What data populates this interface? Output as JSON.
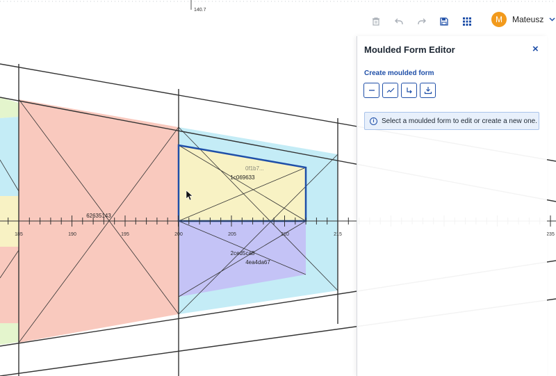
{
  "top_ruler_label": "140.7",
  "ruler": {
    "ticks": [
      "185",
      "190",
      "195",
      "200",
      "205",
      "210",
      "215",
      "235"
    ]
  },
  "shapes": {
    "left_block_label": "62635143",
    "upper_form_label": "1c069633",
    "upper_form_ghost_label": "0f1b7...",
    "lower_form_label": "2ced5ca8",
    "lower_form_sub_label": "4ea4da67"
  },
  "toolbar": {
    "delete_icon": "trash-icon",
    "undo_icon": "undo-icon",
    "redo_icon": "redo-icon",
    "save_icon": "save-icon",
    "apps_icon": "grid-icon"
  },
  "user": {
    "initial": "M",
    "name": "Mateusz",
    "avatar_color": "#f29a1c"
  },
  "panel": {
    "title": "Moulded Form Editor",
    "close_label": "×",
    "section_title": "Create moulded form",
    "tools": [
      "line-tool-icon",
      "polyline-tool-icon",
      "arrow-path-tool-icon",
      "import-tool-icon"
    ],
    "info_message": "Select a moulded form to edit or create a new one.",
    "info_icon": "i"
  },
  "colors": {
    "accent": "#1f4fa8",
    "salmon": "#f9c9be",
    "cyan": "#c4ecf6",
    "yellow": "#f8f2c4",
    "lavender": "#c4c3f6",
    "green": "#e4f5cd"
  }
}
